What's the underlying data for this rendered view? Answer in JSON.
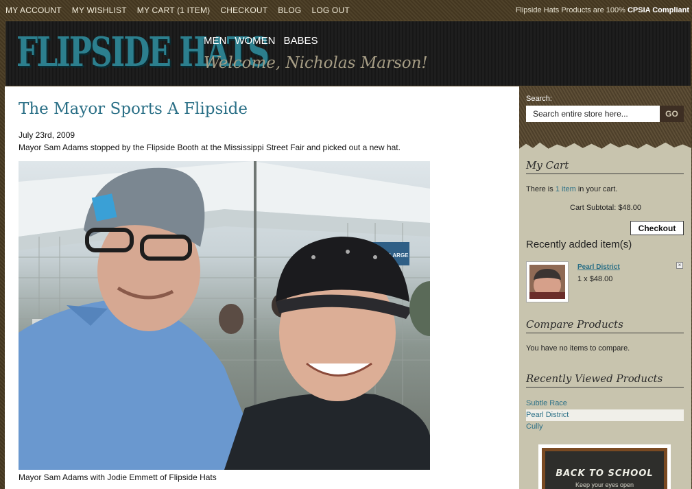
{
  "topnav": {
    "items": [
      "MY ACCOUNT",
      "MY WISHLIST",
      "MY CART (1 ITEM)",
      "CHECKOUT",
      "BLOG",
      "LOG OUT"
    ],
    "cpsia_prefix": "Flipside Hats Products are 100%",
    "cpsia_strong": "CPSIA Compliant"
  },
  "header": {
    "logo": "FLIPSIDE HATS",
    "nav": [
      "MEN",
      "WOMEN",
      "BABES"
    ],
    "welcome": "Welcome, Nicholas Marson!"
  },
  "post": {
    "title": "The Mayor Sports A Flipside",
    "date": "July 23rd, 2009",
    "intro": "Mayor Sam Adams stopped by the Flipside Booth at the Mississippi Street Fair and picked out a new hat.",
    "caption": "Mayor Sam Adams with Jodie Emmett of Flipside Hats",
    "photo_sign": "EXTRA LARGE"
  },
  "sidebar": {
    "search_label": "Search:",
    "search_placeholder": "Search entire store here...",
    "search_button": "GO",
    "cart": {
      "title": "My Cart",
      "text_before": "There is",
      "item_link": "1 item",
      "text_after": "in your cart.",
      "subtotal": "Cart Subtotal: $48.00",
      "checkout": "Checkout",
      "recent_title": "Recently added item(s)",
      "product_name": "Pearl District",
      "product_qty": "1 x $48.00",
      "remove": "×"
    },
    "compare": {
      "title": "Compare Products",
      "text": "You have no items to compare."
    },
    "recently_viewed": {
      "title": "Recently Viewed Products",
      "items": [
        "Subtle Race",
        "Pearl District",
        "Cully"
      ]
    },
    "promo": {
      "title": "BACK TO SCHOOL",
      "sub": "Keep your eyes open"
    }
  }
}
